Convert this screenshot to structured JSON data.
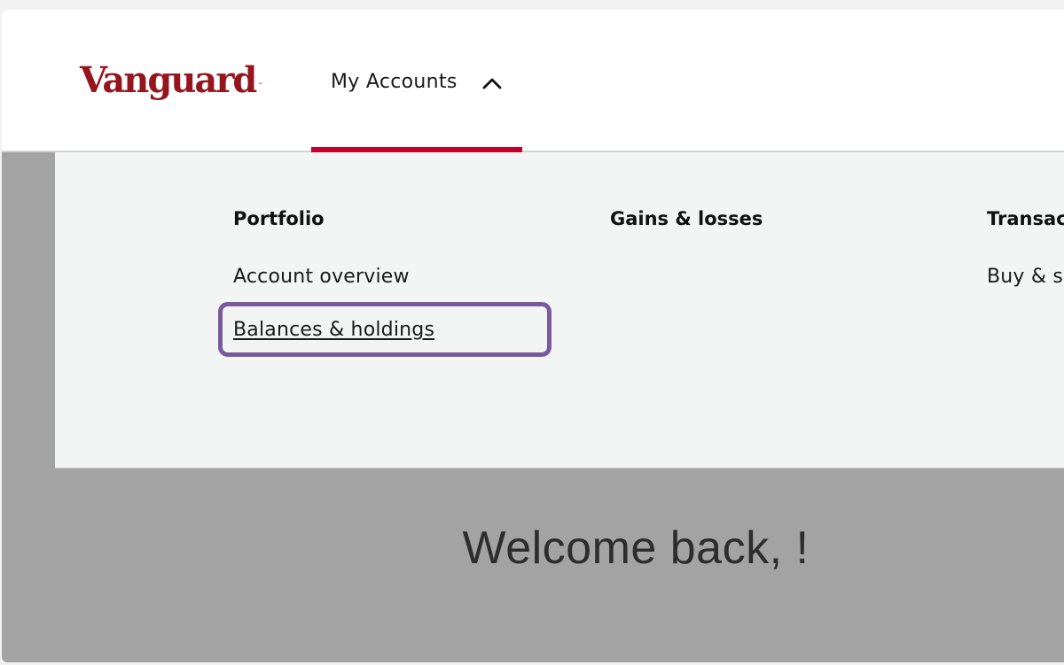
{
  "brand": {
    "logo_text": "Vanguard",
    "logo_mark": "™",
    "color": "#96151d"
  },
  "nav": {
    "tab_label": "My Accounts",
    "tab_icon": "chevron-up-icon",
    "active_accent": "#c20029"
  },
  "menu": {
    "columns": [
      {
        "title": "Portfolio",
        "links": [
          "Account overview",
          "Balances & holdings"
        ]
      },
      {
        "title": "Gains & losses",
        "links": []
      },
      {
        "title": "Transac",
        "links": [
          "Buy & s"
        ]
      }
    ],
    "highlight_color": "#7a5a9d"
  },
  "main": {
    "greeting": "Welcome back, !"
  }
}
